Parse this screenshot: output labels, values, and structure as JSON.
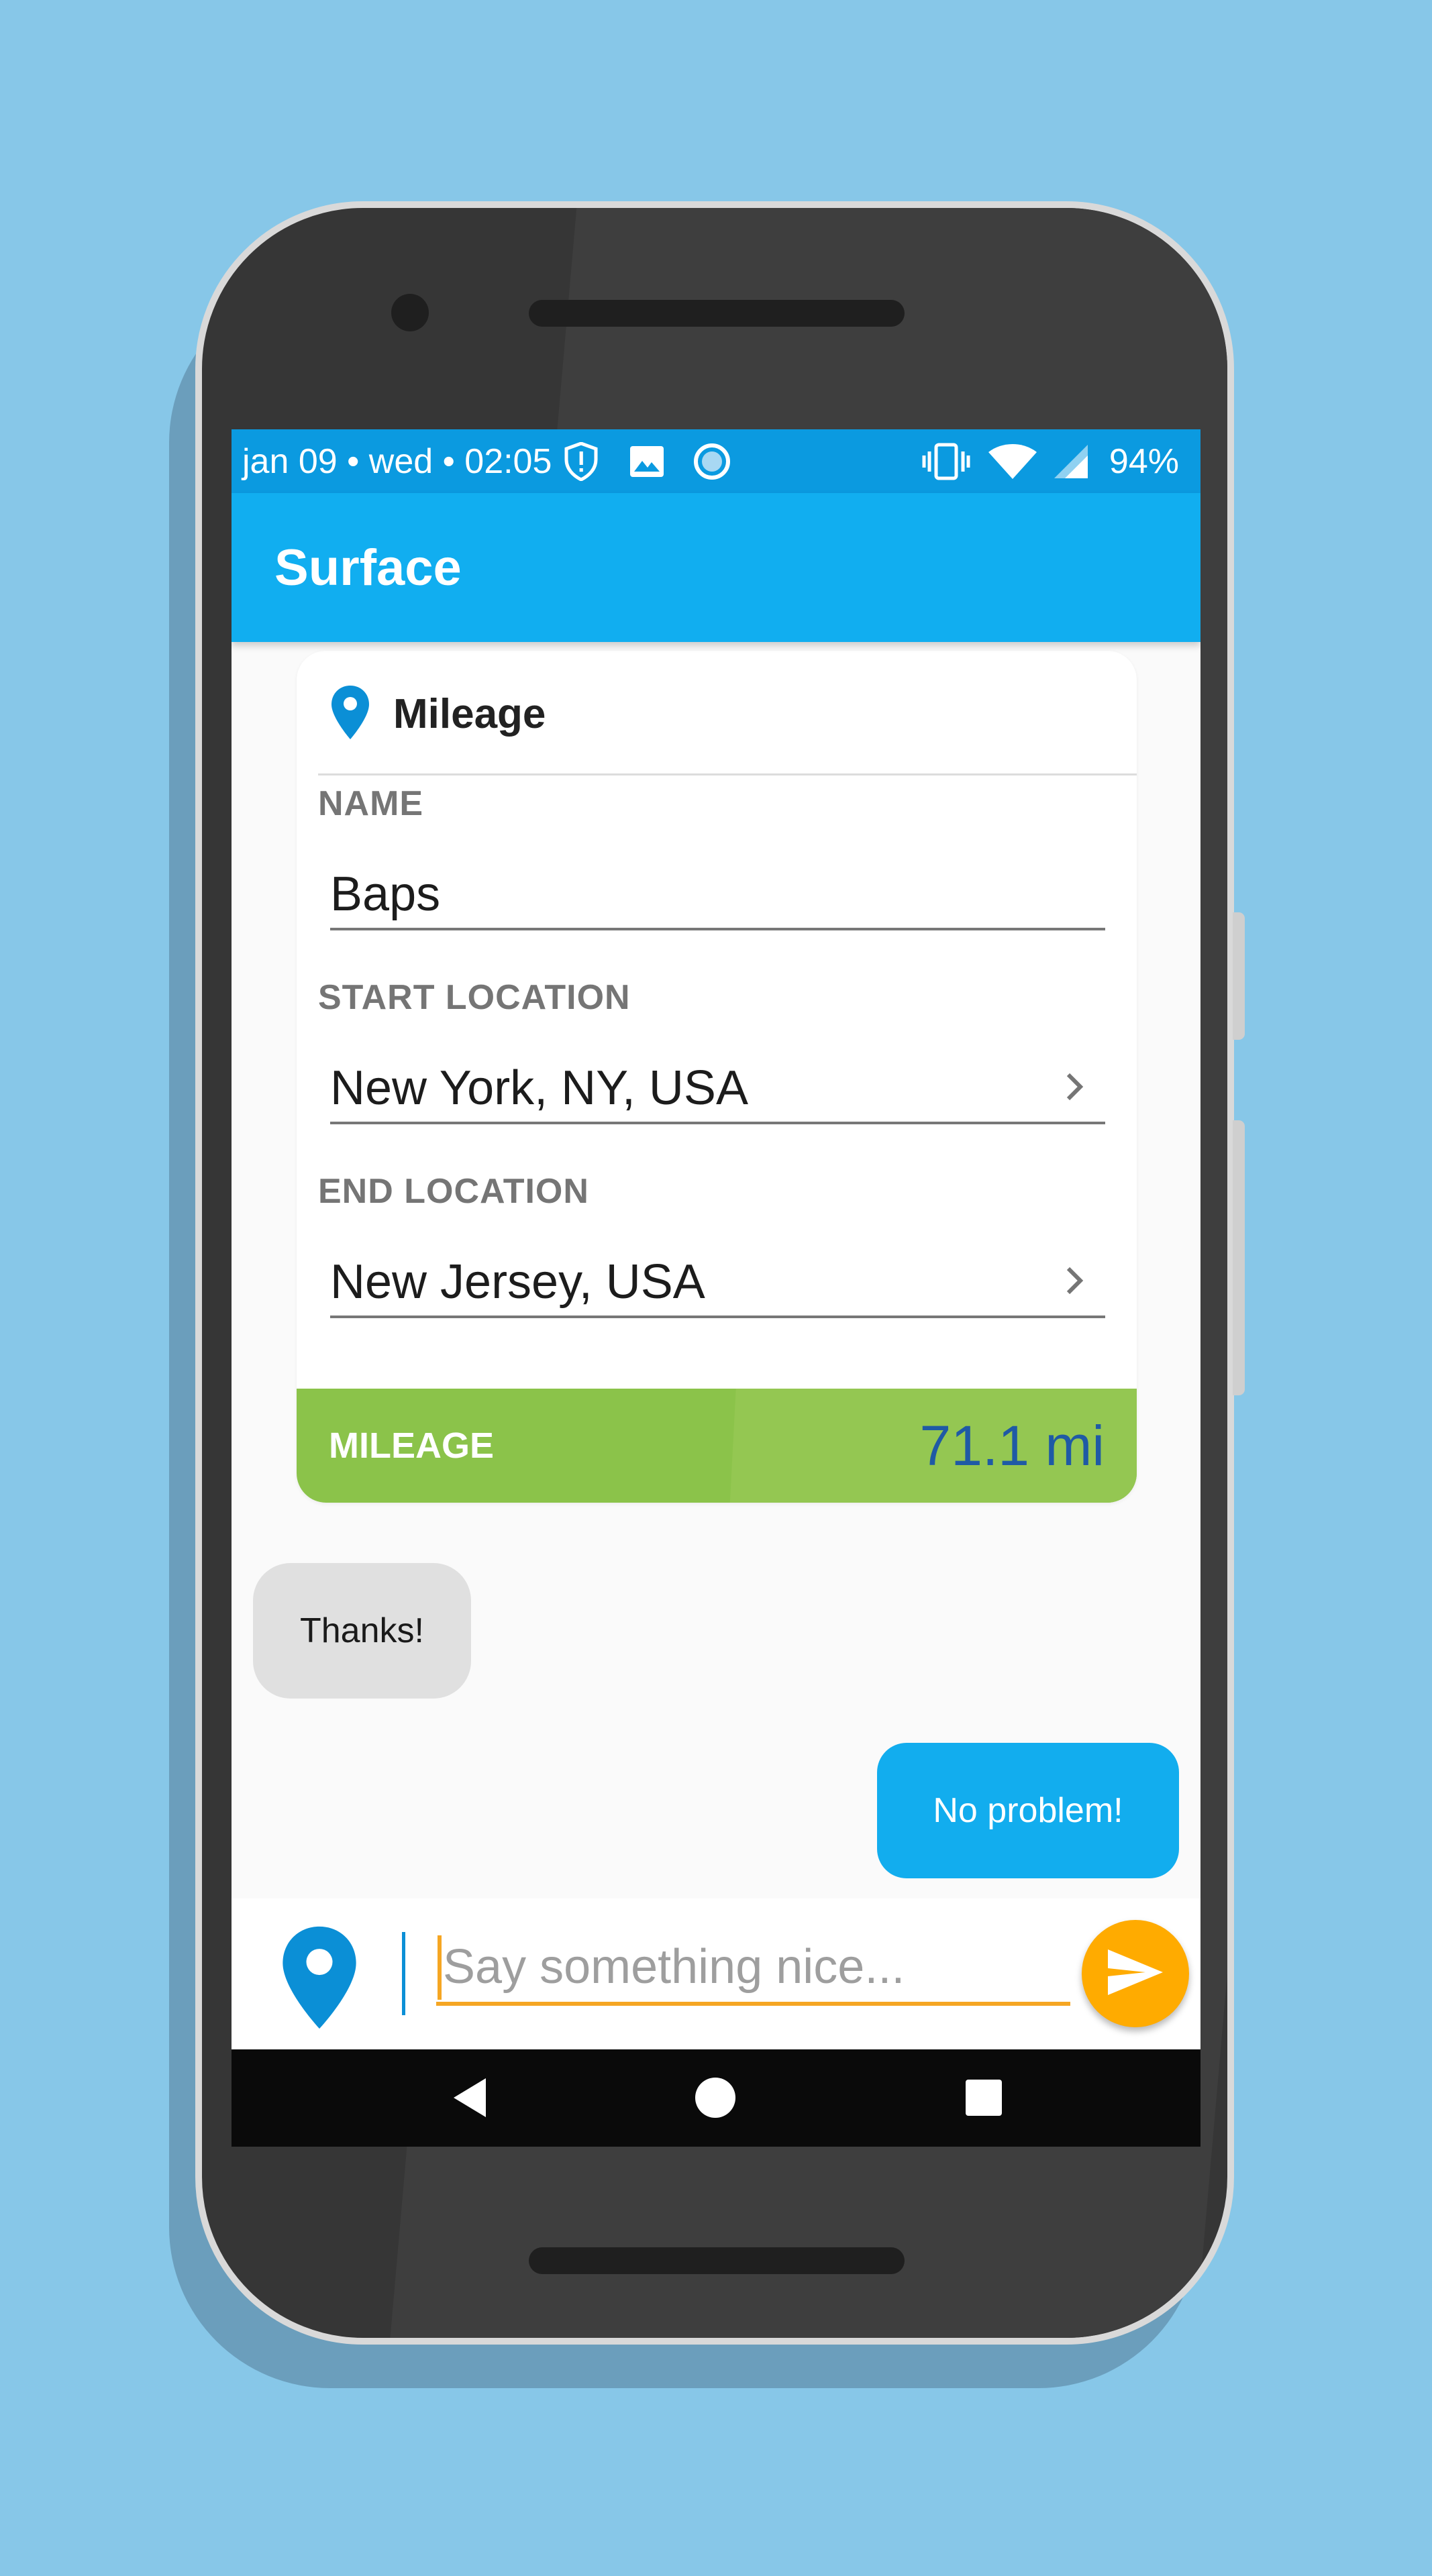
{
  "status_bar": {
    "datetime": "jan 09 • wed • 02:05",
    "battery": "94%",
    "icons": [
      "shield-alert-icon",
      "image-icon",
      "circle-icon",
      "vibrate-icon",
      "wifi-icon",
      "signal-icon"
    ]
  },
  "app_bar": {
    "title": "Surface"
  },
  "card": {
    "header": {
      "icon": "location-pin-icon",
      "title": "Mileage"
    },
    "fields": [
      {
        "label": "NAME",
        "value": "Baps"
      },
      {
        "label": "START LOCATION",
        "value": "New York, NY, USA"
      },
      {
        "label": "END LOCATION",
        "value": "New Jersey, USA"
      }
    ],
    "mileage": {
      "label": "MILEAGE",
      "value": "71.1 mi"
    }
  },
  "chat": {
    "incoming": "Thanks!",
    "outgoing": "No problem!"
  },
  "composer": {
    "placeholder": "Say something nice...",
    "value": ""
  },
  "colors": {
    "status_bar": "#0b9ae0",
    "app_bar": "#11aef0",
    "mileage_bar": "#8bc34a",
    "mileage_value": "#1f5aa5",
    "outgoing_bubble": "#12adee",
    "send_button": "#ffab00",
    "pin": "#0b8fd6"
  }
}
